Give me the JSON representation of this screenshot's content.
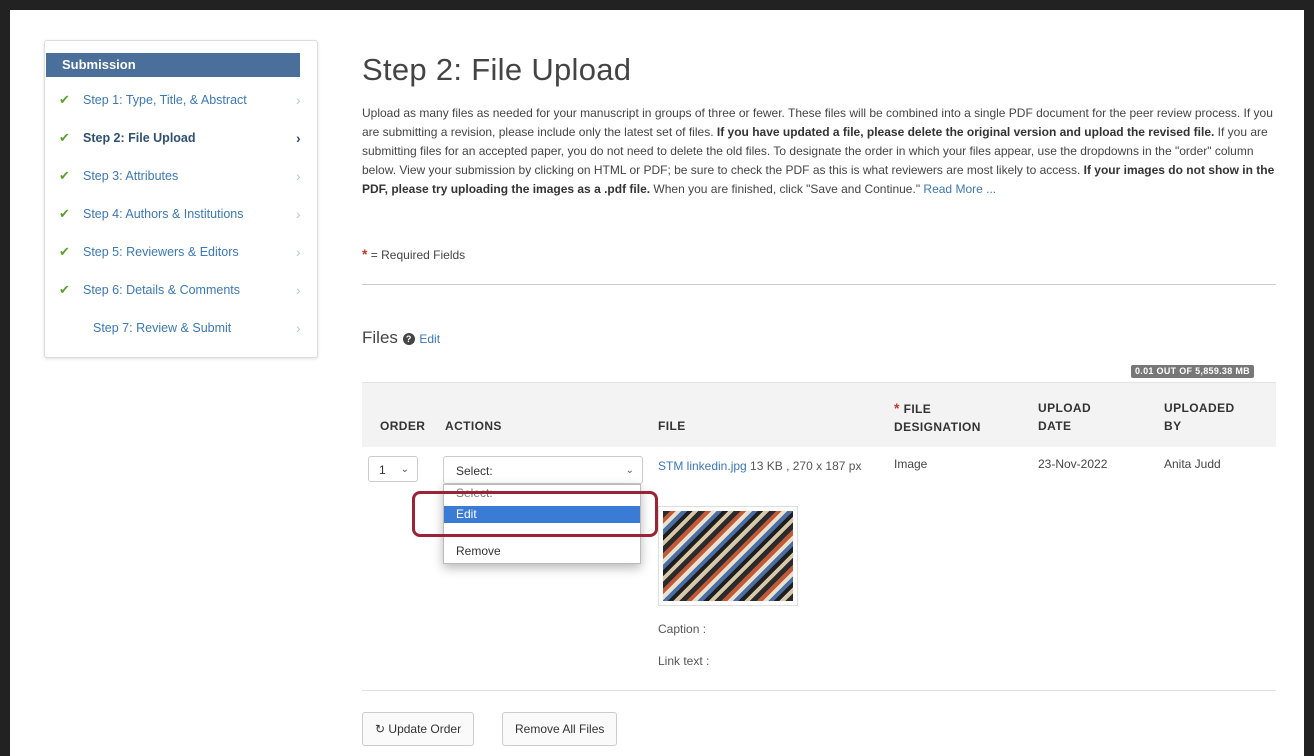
{
  "sidebar": {
    "header": "Submission",
    "steps": [
      {
        "label": "Step 1: Type, Title, & Abstract",
        "check": "✔",
        "chevron": "›"
      },
      {
        "label": "Step 2: File Upload",
        "check": "✔",
        "chevron": "›"
      },
      {
        "label": "Step 3: Attributes",
        "check": "✔",
        "chevron": "›"
      },
      {
        "label": "Step 4: Authors & Institutions",
        "check": "✔",
        "chevron": "›"
      },
      {
        "label": "Step 5: Reviewers & Editors",
        "check": "✔",
        "chevron": "›"
      },
      {
        "label": "Step 6: Details & Comments",
        "check": "✔",
        "chevron": "›"
      },
      {
        "label": "Step 7: Review & Submit",
        "check": "",
        "chevron": "›"
      }
    ]
  },
  "main": {
    "title": "Step 2: File Upload",
    "intro": {
      "p1": "Upload as many files as needed for your manuscript in groups of three or fewer. These files will be combined into a single PDF document for the peer review process. If you are submitting a revision, please include only the latest set of files. ",
      "b1": "If you have updated a file, please delete the original version and upload the revised file.",
      "p2": " If you are submitting files for an accepted paper, you do not need to delete the old files. To designate the order in which your files appear, use the dropdowns in the \"order\" column below. View your submission by clicking on HTML or PDF; be sure to check the PDF as this is what reviewers are most likely to access. ",
      "b2": "If your images do not show in the PDF, please try uploading the images as a .pdf file.",
      "p3": " When you are finished, click \"Save and Continue.\" ",
      "read_more": "Read More ..."
    },
    "required_star": "*",
    "required_text": " = Required Fields",
    "files": {
      "title": "Files",
      "help_icon": "?",
      "edit_link": "Edit",
      "quota": "0.01 OUT OF 5,859.38 MB"
    },
    "table": {
      "headers": {
        "order": "ORDER",
        "actions": "ACTIONS",
        "file": "FILE",
        "designation_star": "*",
        "designation_1": "FILE",
        "designation_2": "DESIGNATION",
        "upload_1": "UPLOAD",
        "upload_2": "DATE",
        "by_1": "UPLOADED",
        "by_2": "BY"
      },
      "row": {
        "order": "1",
        "action": "Select:",
        "file_link": "STM linkedin.jpg",
        "file_meta": " 13 KB , 270 x 187 px",
        "designation": "Image",
        "date": "23-Nov-2022",
        "uploaded_by": "Anita Judd",
        "caption": "Caption :",
        "link_text": "Link text :"
      },
      "dropdown": {
        "options": [
          "Select:",
          "Edit",
          "Remove"
        ],
        "selected": "Edit"
      }
    },
    "buttons": {
      "update_icon": "↻",
      "update": " Update Order",
      "remove_all": "Remove All Files"
    }
  }
}
